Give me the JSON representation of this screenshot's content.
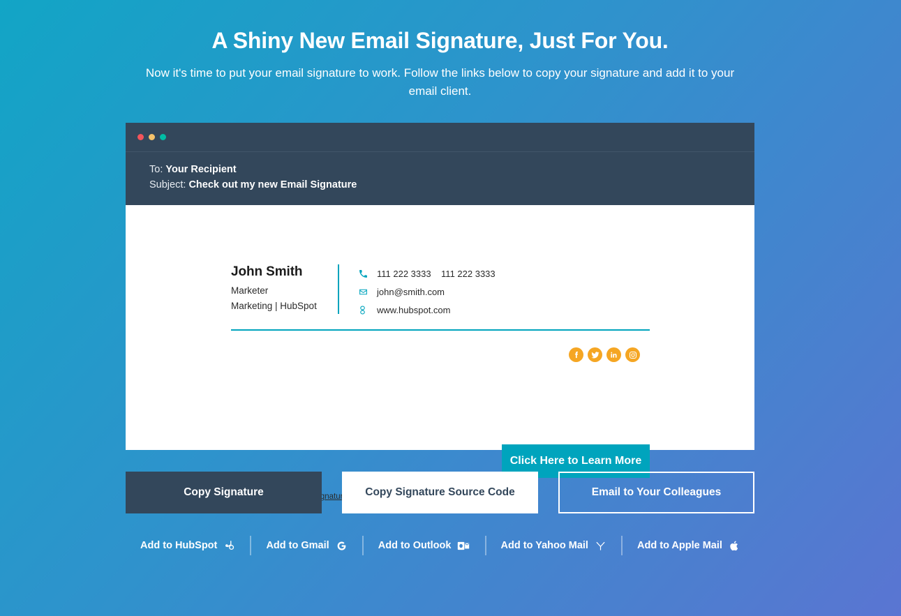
{
  "hero": {
    "title": "A Shiny New Email Signature, Just For You.",
    "subtitle": "Now it's time to put your email signature to work. Follow the links below to copy your signature and add it to your email client."
  },
  "email_card": {
    "window_dots": [
      "red",
      "yellow",
      "green"
    ],
    "to_label": "To:",
    "to_value": "Your Recipient",
    "subject_label": "Subject:",
    "subject_value": "Check out my new Email Signature"
  },
  "signature": {
    "name": "John Smith",
    "role": "Marketer",
    "company": "Marketing | HubSpot",
    "contacts": [
      {
        "icon": "phone-icon",
        "text": "111 222 3333    111 222 3333"
      },
      {
        "icon": "envelope-icon",
        "text": "john@smith.com"
      },
      {
        "icon": "link-icon",
        "text": "www.hubspot.com"
      }
    ],
    "socials": [
      {
        "icon": "facebook-icon",
        "name": "Facebook"
      },
      {
        "icon": "twitter-icon",
        "name": "Twitter"
      },
      {
        "icon": "linkedin-icon",
        "name": "LinkedIn"
      },
      {
        "icon": "instagram-icon",
        "name": "Instagram"
      }
    ],
    "cta_label": "Click Here to Learn More",
    "free_link_label": "Create Your Own Free Signature",
    "accent_color": "#00a4bd",
    "social_color": "#f5a623"
  },
  "actions": {
    "copy_signature": "Copy Signature",
    "copy_source_code": "Copy Signature Source Code",
    "email_colleagues": "Email to Your Colleagues"
  },
  "add_links": [
    {
      "label": "Add to HubSpot",
      "icon": "hubspot-icon"
    },
    {
      "label": "Add to Gmail",
      "icon": "google-icon"
    },
    {
      "label": "Add to Outlook",
      "icon": "outlook-icon"
    },
    {
      "label": "Add to Yahoo Mail",
      "icon": "yahoo-icon"
    },
    {
      "label": "Add to Apple Mail",
      "icon": "apple-icon"
    }
  ],
  "theme": {
    "gradient_start": "#12a5c6",
    "gradient_end": "#5a75d2",
    "dark": "#33475b",
    "accent": "#00a4bd",
    "dot_red": "#f2545b",
    "dot_yellow": "#f5c26b",
    "dot_green": "#00bda5"
  }
}
